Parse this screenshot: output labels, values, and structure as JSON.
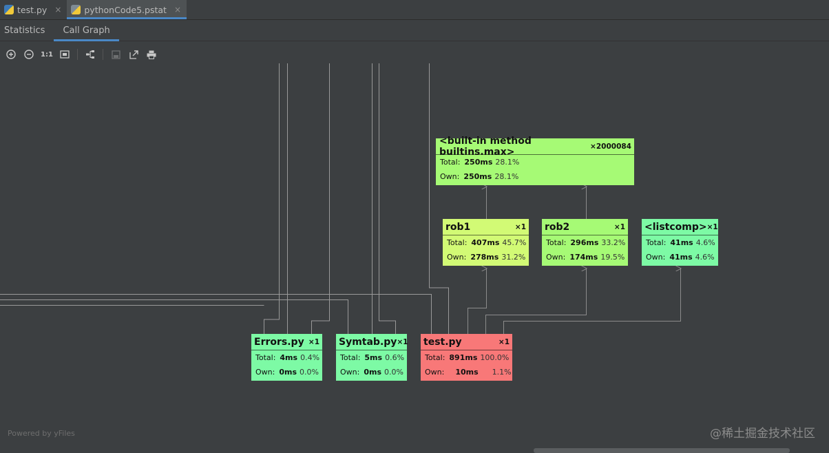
{
  "editor_tabs": [
    {
      "label": "test.py",
      "icon": "python-file-icon",
      "active": false
    },
    {
      "label": "pythonCode5.pstat",
      "icon": "pstat-file-icon",
      "active": true
    }
  ],
  "close_glyph": "×",
  "sub_tabs": [
    {
      "label": "Statistics",
      "active": false
    },
    {
      "label": "Call Graph",
      "active": true
    }
  ],
  "toolbar": {
    "zoom_in_icon": "zoom-in-icon",
    "zoom_out_icon": "zoom-out-icon",
    "actual_size_label": "1:1",
    "fit_icon": "fit-content-icon",
    "layout_icon": "layout-icon",
    "save_icon": "save-icon",
    "export_icon": "export-icon",
    "print_icon": "print-icon"
  },
  "nodes": {
    "builtins_max": {
      "name": "<built-in method builtins.max>",
      "count": "×2000084",
      "total_label": "Total:",
      "total_ms": "250ms",
      "total_pct": "28.1%",
      "own_label": "Own:",
      "own_ms": "250ms",
      "own_pct": "28.1%",
      "color": "#a6fa75"
    },
    "rob1": {
      "name": "rob1",
      "count": "×1",
      "total_label": "Total:",
      "total_ms": "407ms",
      "total_pct": "45.7%",
      "own_label": "Own:",
      "own_ms": "278ms",
      "own_pct": "31.2%",
      "color": "#d2fa75"
    },
    "rob2": {
      "name": "rob2",
      "count": "×1",
      "total_label": "Total:",
      "total_ms": "296ms",
      "total_pct": "33.2%",
      "own_label": "Own:",
      "own_ms": "174ms",
      "own_pct": "19.5%",
      "color": "#a6fa75"
    },
    "listcomp": {
      "name": "<listcomp>",
      "count": "×1",
      "total_label": "Total:",
      "total_ms": "41ms",
      "total_pct": "4.6%",
      "own_label": "Own:",
      "own_ms": "41ms",
      "own_pct": "4.6%",
      "color": "#7dfaa5"
    },
    "errors": {
      "name": "Errors.py",
      "count": "×1",
      "total_label": "Total:",
      "total_ms": "4ms",
      "total_pct": "0.4%",
      "own_label": "Own:",
      "own_ms": "0ms",
      "own_pct": "0.0%",
      "color": "#7dfaa5"
    },
    "symtab": {
      "name": "Symtab.py",
      "count": "×1",
      "total_label": "Total:",
      "total_ms": "5ms",
      "total_pct": "0.6%",
      "own_label": "Own:",
      "own_ms": "0ms",
      "own_pct": "0.0%",
      "color": "#7dfaa5"
    },
    "testpy": {
      "name": "test.py",
      "count": "×1",
      "total_label": "Total:",
      "total_ms": "891ms",
      "total_pct": "100.0%",
      "own_label": "Own:",
      "own_ms": "10ms",
      "own_pct": "1.1%",
      "color": "#f87878"
    }
  },
  "powered_by": "Powered by yFiles",
  "watermark": "@稀土掘金技术社区",
  "colors": {
    "background": "#3c3f41",
    "accent": "#4a88c7",
    "edge": "#8c8c8c"
  }
}
